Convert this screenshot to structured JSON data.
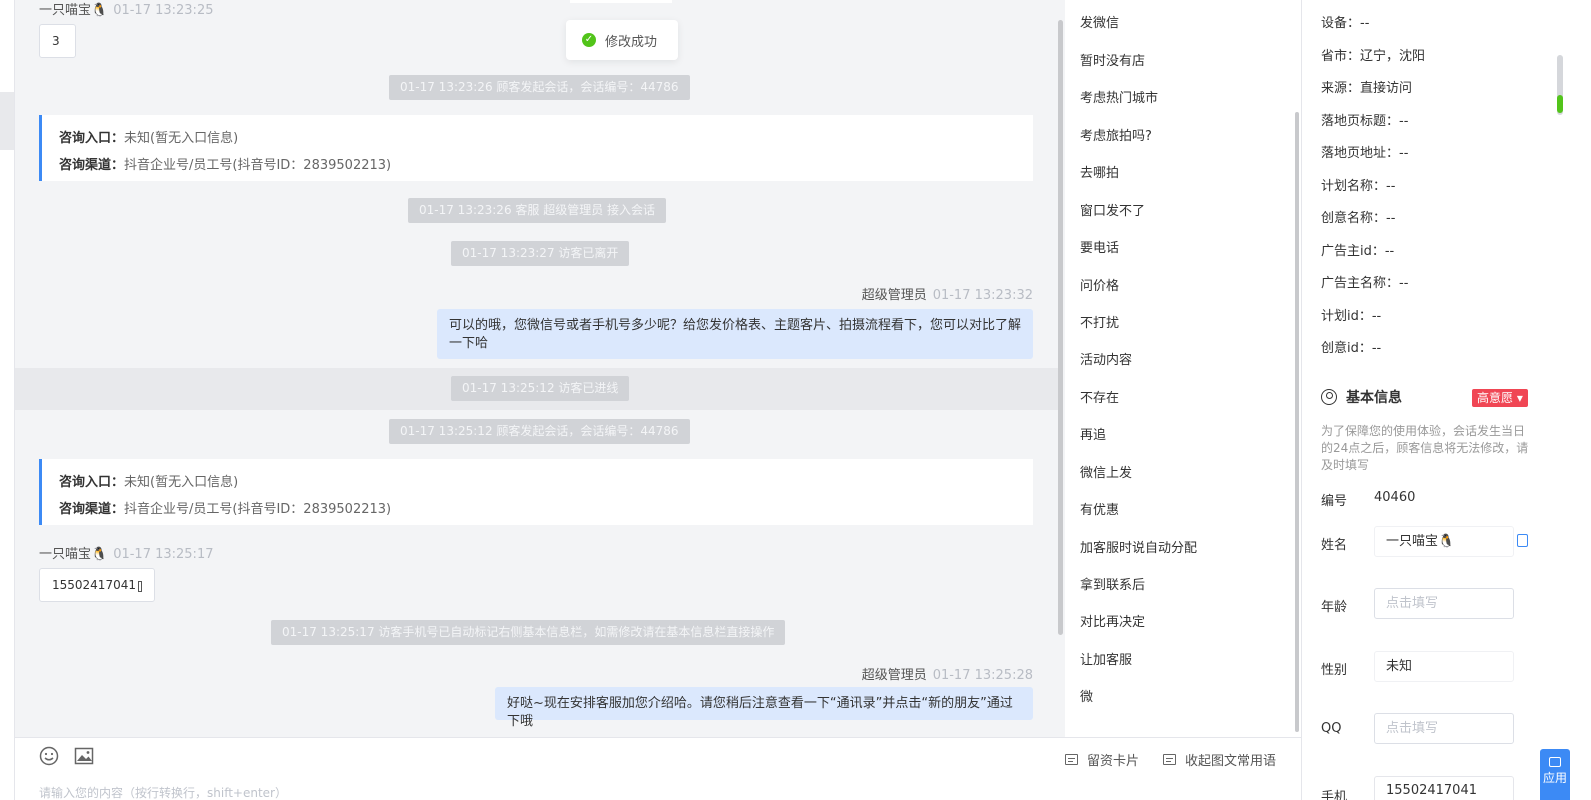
{
  "toast": {
    "text": "修改成功"
  },
  "chat": {
    "messages": {
      "m1_name": "一只喵宝🐧",
      "m1_time": "01-17 13:23:25",
      "m1_text": "3",
      "sys1": "01-17 13:23:26 顾客发起会话，会话编号：44786",
      "card1": {
        "entry_label": "咨询入口：",
        "entry_value": "未知(暂无入口信息)",
        "channel_label": "咨询渠道：",
        "channel_value": "抖音企业号/员工号(抖音号ID：2839502213)"
      },
      "sys2": "01-17 13:23:26 客服 超级管理员 接入会话",
      "sys3": "01-17 13:23:27 访客已离开",
      "m2_name": "超级管理员",
      "m2_time": "01-17 13:23:32",
      "m2_text": "可以的哦，您微信号或者手机号多少呢？给您发价格表、主题客片、拍摄流程看下，您可以对比了解一下哈",
      "sys4": "01-17 13:25:12 访客已进线",
      "sys5": "01-17 13:25:12 顾客发起会话，会话编号：44786",
      "card2": {
        "entry_label": "咨询入口：",
        "entry_value": "未知(暂无入口信息)",
        "channel_label": "咨询渠道：",
        "channel_value": "抖音企业号/员工号(抖音号ID：2839502213)"
      },
      "m3_name": "一只喵宝🐧",
      "m3_time": "01-17 13:25:17",
      "m3_text": "15502417041",
      "sys6": "01-17 13:25:17 访客手机号已自动标记右侧基本信息栏，如需修改请在基本信息栏直接操作",
      "m4_name": "超级管理员",
      "m4_time": "01-17 13:25:28",
      "m4_text": "好哒~现在安排客服加您介绍哈。请您稍后注意查看一下“通讯录”并点击“新的朋友”通过下哦"
    }
  },
  "input": {
    "placeholder": "请输入您的内容（按行转换行，shift+enter）",
    "emoji_icon": "smile-icon",
    "image_icon": "image-icon",
    "card_btn": "留资卡片",
    "collapse_btn": "收起图文常用语"
  },
  "phrases": [
    "发微信",
    "暂时没有店",
    "考虑热门城市",
    "考虑旅拍吗?",
    "去哪拍",
    "窗口发不了",
    "要电话",
    "问价格",
    "不打扰",
    "活动内容",
    "不存在",
    "再追",
    "微信上发",
    "有优惠",
    "加客服时说自动分配",
    "拿到联系后",
    "对比再决定",
    "让加客服",
    "微"
  ],
  "visitor": {
    "device": "设备：--",
    "province": "省市：辽宁，沈阳",
    "source": "来源：直接访问",
    "landing_title": "落地页标题：--",
    "landing_url": "落地页地址：--",
    "plan_name": "计划名称：--",
    "creative_name": "创意名称：--",
    "advertiser_id": "广告主id：--",
    "advertiser_name": "广告主名称：--",
    "plan_id": "计划id：--",
    "creative_id": "创意id：--"
  },
  "basic": {
    "title": "基本信息",
    "intent": "高意愿 ▾",
    "intent_color": "#f04654",
    "hint": "为了保障您的使用体验，会话发生当日的24点之后，顾客信息将无法修改，请及时填写",
    "id_label": "编号",
    "id_value": "40460",
    "name_label": "姓名",
    "name_value": "一只喵宝🐧",
    "age_label": "年龄",
    "age_placeholder": "点击填写",
    "gender_label": "性别",
    "gender_value": "未知",
    "qq_label": "QQ",
    "qq_placeholder": "点击填写",
    "phone_label": "手机",
    "phone_value": "15502417041"
  },
  "float_btn": "应用"
}
